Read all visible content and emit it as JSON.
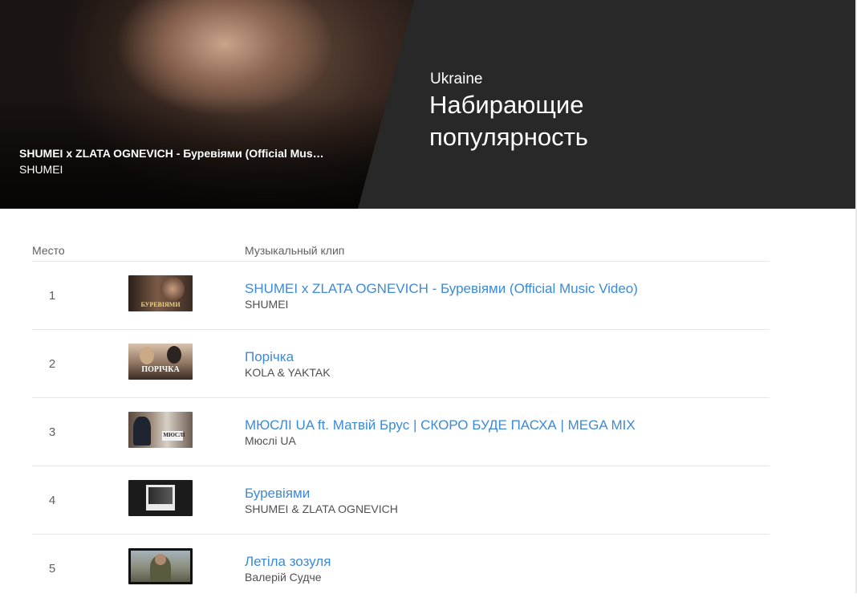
{
  "banner": {
    "video_title": "SHUMEI x ZLATA OGNEVICH - Буревіями (Official Mus…",
    "video_artist": "SHUMEI",
    "country": "Ukraine",
    "heading": "Набирающие популярность"
  },
  "table": {
    "col_rank": "Место",
    "col_video": "Музыкальный клип",
    "rows": [
      {
        "rank": "1",
        "title": "SHUMEI x ZLATA OGNEVICH - Буревіями (Official Music Video)",
        "artist": "SHUMEI",
        "thumb_text": "БУРЕВІЯМИ"
      },
      {
        "rank": "2",
        "title": "Порічка",
        "artist": "KOLA & YAKTAK",
        "thumb_text": "ПОРІЧКА"
      },
      {
        "rank": "3",
        "title": "МЮСЛІ UA ft. Матвій Брус | СКОРО БУДЕ ПАСХА | MEGA MIX",
        "artist": "Мюслі UA",
        "thumb_text": "МЮСЛІ"
      },
      {
        "rank": "4",
        "title": "Буревіями",
        "artist": "SHUMEI & ZLATA OGNEVICH",
        "thumb_text": ""
      },
      {
        "rank": "5",
        "title": "Летіла зозуля",
        "artist": "Валерій Судче",
        "thumb_text": ""
      }
    ]
  }
}
